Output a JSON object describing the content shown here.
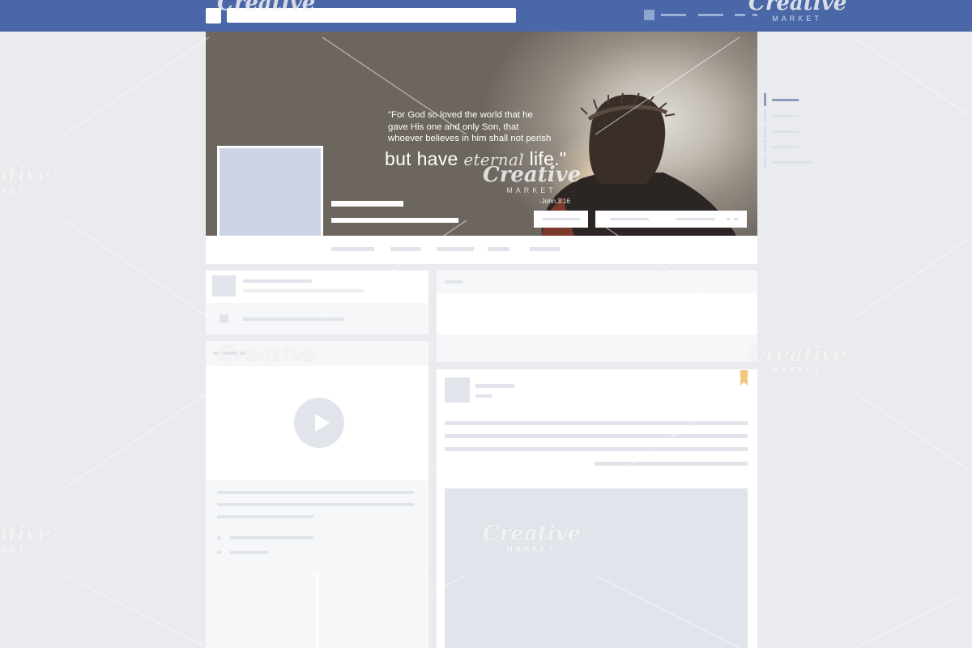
{
  "topbar": {
    "search": {
      "value": "",
      "placeholder": ""
    }
  },
  "cover": {
    "quote_lines": [
      "\"For God so loved the world that he",
      "gave His one and only Son, that",
      "whoever believes in him shall not perish"
    ],
    "quote_big_prefix": "but have ",
    "quote_big_script": "eternal",
    "quote_big_suffix": " life.\"",
    "verse_ref": "-John 3:16"
  },
  "watermark": {
    "word": "Creative",
    "sub": "MARKET"
  },
  "colors": {
    "topbar": "#4a67a8",
    "page_bg": "#e9ebee",
    "placeholder_blue": "#cdd4e6",
    "placeholder_gray": "#e1e4ea",
    "bookmark": "#f5c77e"
  },
  "icons": {
    "play": "play-icon",
    "bookmark": "bookmark-icon"
  }
}
